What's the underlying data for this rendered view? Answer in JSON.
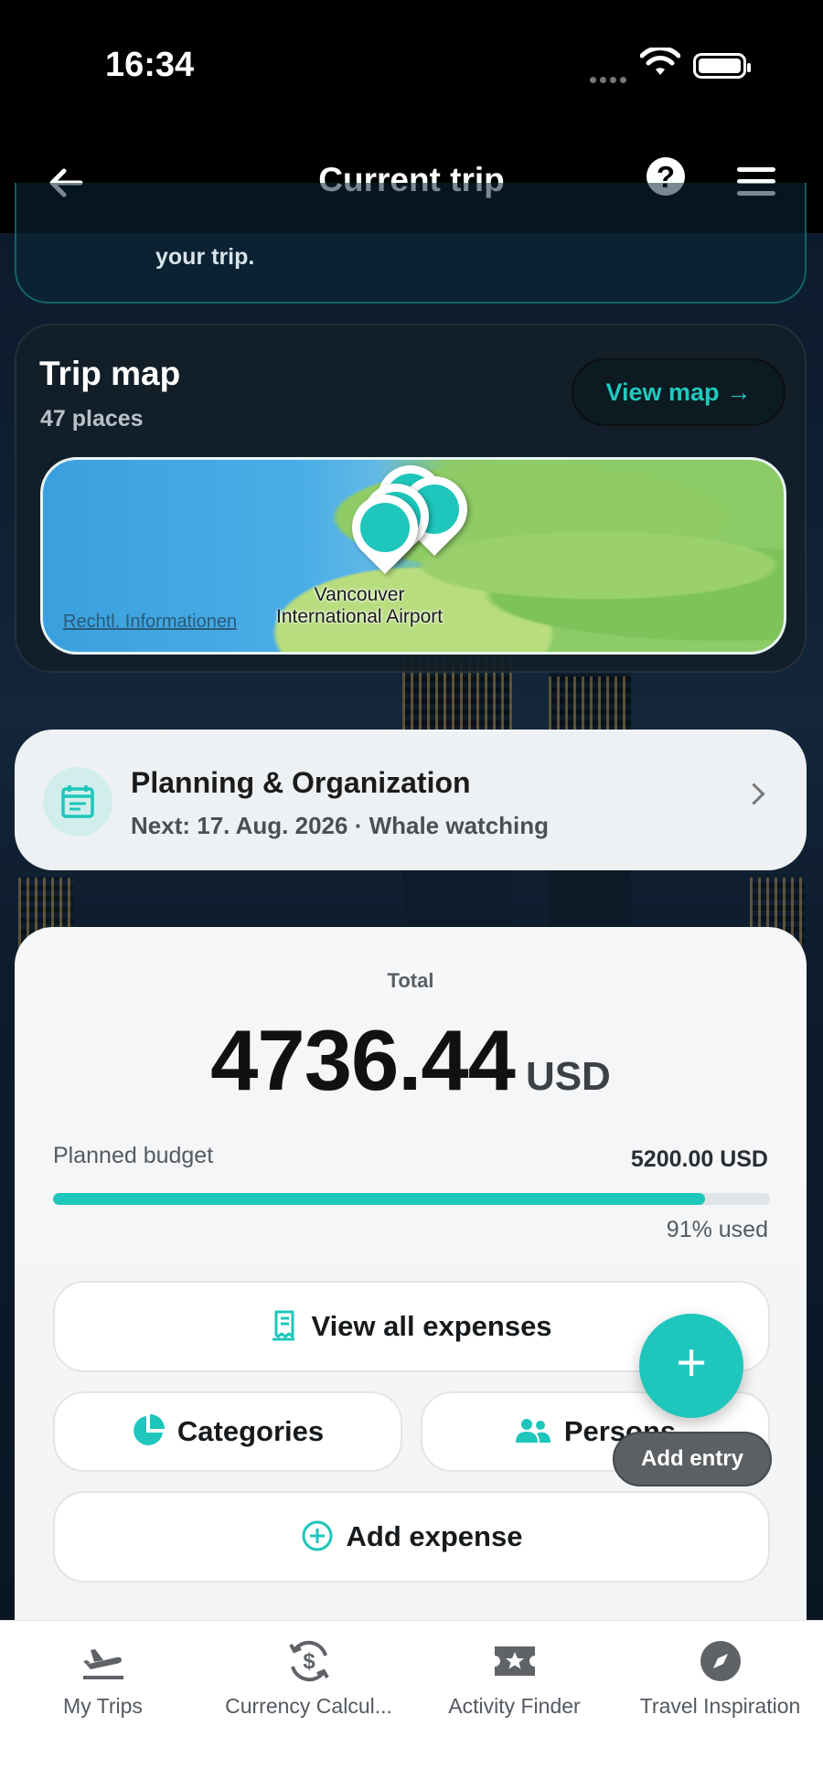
{
  "status_bar": {
    "time": "16:34"
  },
  "nav": {
    "title": "Current trip"
  },
  "photobook": {
    "text": "your trip."
  },
  "trip_map": {
    "title": "Trip map",
    "places": "47 places",
    "view_map_label": "View map",
    "map_legal_link": "Rechtl. Informationen",
    "map_label_line1": "Vancouver",
    "map_label_line2": "International Airport"
  },
  "planning": {
    "title": "Planning & Organization",
    "next": "Next: 17. Aug. 2026 · Whale watching"
  },
  "expenses": {
    "total_label": "Total",
    "total_amount": "4736.44",
    "currency": "USD",
    "budget_label": "Planned budget",
    "budget_value": "5200.00 USD",
    "used_fraction": 0.91,
    "used_label": "91% used",
    "view_all_label": "View all expenses",
    "categories_label": "Categories",
    "persons_label": "Persons",
    "add_expense_label": "Add expense"
  },
  "fab": {
    "symbol": "+",
    "label": "Add entry"
  },
  "tabs": [
    {
      "label": "My Trips",
      "icon": "plane-icon"
    },
    {
      "label": "Currency Calcul...",
      "icon": "currency-exchange-icon"
    },
    {
      "label": "Activity Finder",
      "icon": "ticket-star-icon"
    },
    {
      "label": "Travel Inspiration",
      "icon": "compass-icon"
    }
  ],
  "colors": {
    "accent": "#1ec6bb",
    "navbar": "#000000",
    "card_light": "#eef1f3"
  }
}
